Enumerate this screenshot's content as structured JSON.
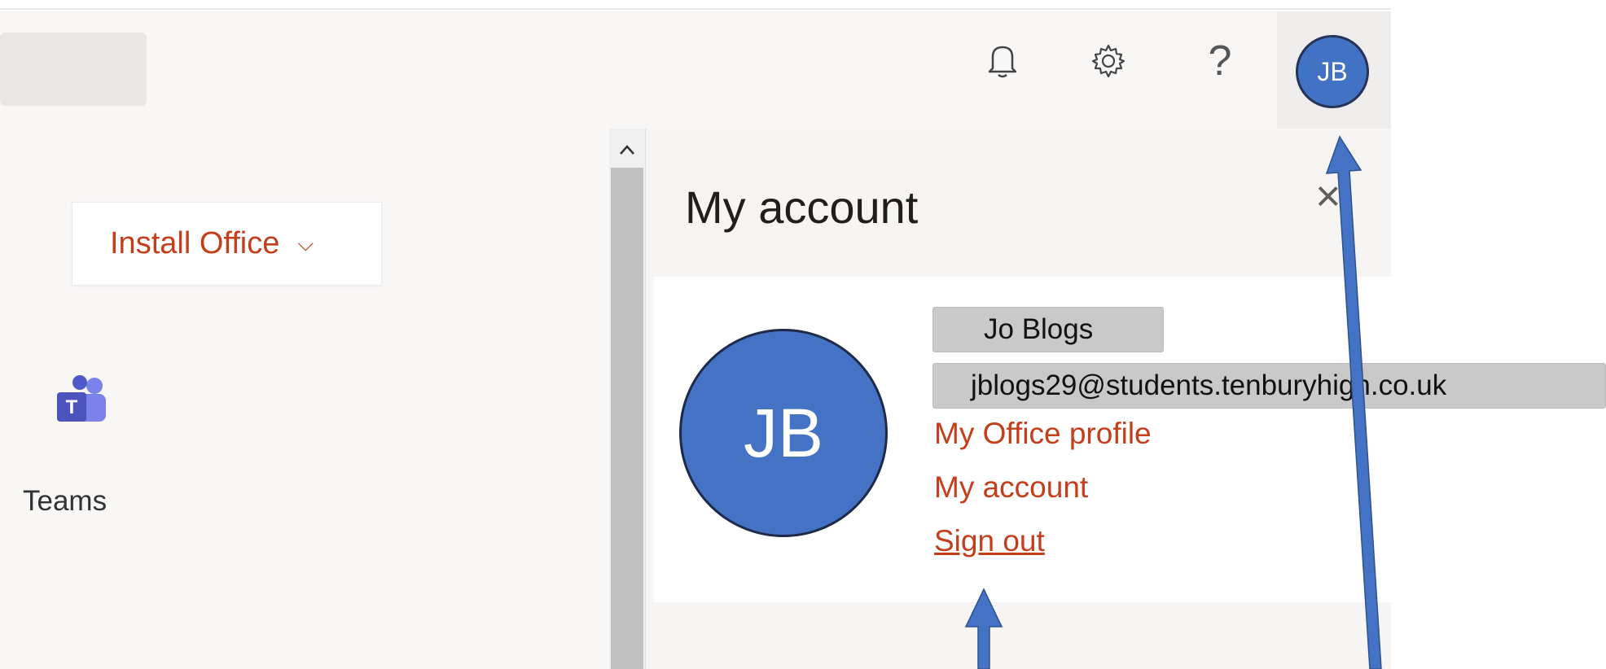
{
  "header": {
    "notifications_icon": "bell-icon",
    "settings_icon": "gear-icon",
    "help_label": "?",
    "avatar_initials": "JB"
  },
  "install": {
    "label": "Install Office",
    "chevron": "⌵"
  },
  "apps": [
    {
      "label": "Teams",
      "icon": "teams-icon"
    }
  ],
  "panel": {
    "title": "My account",
    "close_label": "×",
    "avatar_initials": "JB",
    "user_name": "Jo Blogs",
    "user_email": "jblogs29@students.tenburyhigh.co.uk",
    "links": {
      "profile": "My Office profile",
      "account": "My account",
      "sign_out": "Sign out"
    }
  },
  "colors": {
    "accent": "#c43e1c",
    "avatar": "#4472c4",
    "annotation_arrow": "#4472c4"
  }
}
